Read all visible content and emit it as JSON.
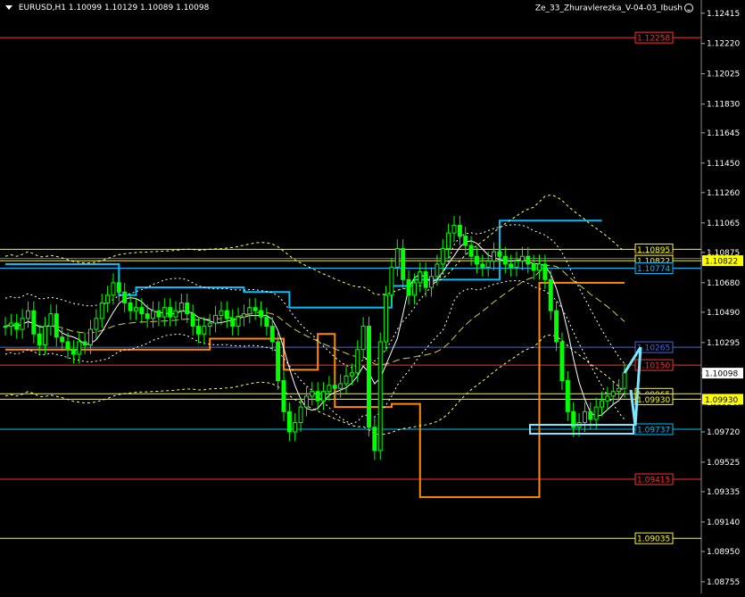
{
  "header": {
    "symbol": "EURUSD,H1",
    "ohlc": "1.10099 1.10129 1.10089 1.10098",
    "indicator": "Ze_33_Zhuravlerezka_V-04-03_Ibush"
  },
  "colors": {
    "background": "#000000",
    "candle_bull": "#00ff00",
    "candle_bear": "#00ff00",
    "axis_text": "#ffffff",
    "cyan_level": "#00bfff",
    "orange_level": "#ff8c00",
    "yellow": "#ffff00",
    "blue": "#0000cd",
    "red": "#ff3030",
    "channel": "#ffff66",
    "arrow": "#7fe6ff"
  },
  "chart_data": {
    "type": "line",
    "title": "EURUSD,H1",
    "ylim": [
      1.0868,
      1.125
    ],
    "y_ticks": [
      "1.12415",
      "1.12220",
      "1.12025",
      "1.11830",
      "1.11645",
      "1.11450",
      "1.11260",
      "1.11065",
      "1.10875",
      "1.10680",
      "1.10490",
      "1.10295",
      "1.10100",
      "1.09910",
      "1.09720",
      "1.09525",
      "1.09335",
      "1.09140",
      "1.08950",
      "1.08755"
    ],
    "grid": false,
    "current_price": "1.10098",
    "close_series": [
      1.104,
      1.1042,
      1.1038,
      1.1045,
      1.105,
      1.1035,
      1.1028,
      1.104,
      1.1048,
      1.1033,
      1.103,
      1.1025,
      1.1022,
      1.103,
      1.1028,
      1.1038,
      1.1045,
      1.1055,
      1.106,
      1.1068,
      1.1062,
      1.1055,
      1.105,
      1.1052,
      1.1048,
      1.1045,
      1.105,
      1.1046,
      1.1052,
      1.1046,
      1.105,
      1.1055,
      1.1048,
      1.104,
      1.1035,
      1.104,
      1.1042,
      1.1047,
      1.105,
      1.1045,
      1.104,
      1.1046,
      1.1048,
      1.1052,
      1.105,
      1.1046,
      1.104,
      1.103,
      1.1005,
      1.0985,
      1.0972,
      1.0978,
      1.0988,
      1.0995,
      1.0998,
      1.0992,
      1.0998,
      1.1002,
      1.1,
      1.1003,
      1.1008,
      1.101,
      1.1025,
      1.104,
      1.0975,
      1.096,
      1.103,
      1.106,
      1.1078,
      1.109,
      1.107,
      1.106,
      1.1068,
      1.1075,
      1.1065,
      1.1072,
      1.108,
      1.109,
      1.11,
      1.1105,
      1.1098,
      1.1092,
      1.1085,
      1.108,
      1.1078,
      1.1082,
      1.1088,
      1.1085,
      1.108,
      1.1078,
      1.1082,
      1.1085,
      1.108,
      1.1076,
      1.108,
      1.107,
      1.105,
      1.103,
      1.1005,
      1.0985,
      1.0975,
      1.0978,
      1.0985,
      1.098,
      1.0988,
      1.0992,
      1.0995,
      1.0998,
      1.1,
      1.101
    ],
    "horizontal_levels": [
      {
        "label": "1.12258",
        "value": 1.12258,
        "color": "#ff3030"
      },
      {
        "label": "1.10895",
        "value": 1.10895,
        "color": "#ffff00"
      },
      {
        "label": "1.10837",
        "value": 1.10837,
        "color": "#ff3030"
      },
      {
        "label": "1.10822",
        "value": 1.10822,
        "color": "#ffff00"
      },
      {
        "label": "1.10774",
        "value": 1.10774,
        "color": "#00bfff"
      },
      {
        "label": "1.10265",
        "value": 1.10265,
        "color": "#4169e1"
      },
      {
        "label": "1.10150",
        "value": 1.1015,
        "color": "#ff3030"
      },
      {
        "label": "1.09965",
        "value": 1.09965,
        "color": "#ffff00"
      },
      {
        "label": "1.09930",
        "value": 1.0993,
        "color": "#ffff00"
      },
      {
        "label": "1.09737",
        "value": 1.09737,
        "color": "#00bfff"
      },
      {
        "label": "1.09415",
        "value": 1.09415,
        "color": "#ff3030"
      },
      {
        "label": "1.09035",
        "value": 1.09035,
        "color": "#ffff00"
      }
    ],
    "badge_levels": [
      {
        "label": "1.10822",
        "value": 1.10822,
        "bg": "#ffff00",
        "fg": "#000000"
      },
      {
        "label": "1.10098",
        "value": 1.10098,
        "bg": "#ffffff",
        "fg": "#000000"
      },
      {
        "label": "1.09930",
        "value": 1.0993,
        "bg": "#ffff00",
        "fg": "#000000"
      }
    ],
    "cyan_step": [
      1.108,
      1.108,
      1.108,
      1.108,
      1.108,
      1.108,
      1.108,
      1.108,
      1.108,
      1.108,
      1.108,
      1.108,
      1.108,
      1.108,
      1.108,
      1.108,
      1.108,
      1.108,
      1.108,
      1.108,
      1.106,
      1.106,
      1.106,
      1.1065,
      1.1065,
      1.1065,
      1.1065,
      1.1065,
      1.1065,
      1.1065,
      1.1065,
      1.1065,
      1.1065,
      1.1065,
      1.1065,
      1.1065,
      1.1065,
      1.1065,
      1.1065,
      1.1065,
      1.1065,
      1.1065,
      1.1062,
      1.1062,
      1.1062,
      1.1062,
      1.1062,
      1.1062,
      1.1062,
      1.1062,
      1.1052,
      1.1052,
      1.1052,
      1.1052,
      1.1052,
      1.1052,
      1.1052,
      1.1052,
      1.1052,
      1.1052,
      1.1052,
      1.1052,
      1.1052,
      1.1052,
      1.1052,
      1.1052,
      1.1052,
      1.1052,
      1.1066,
      1.1066,
      1.1066,
      1.1066,
      1.107,
      1.107,
      1.107,
      1.107,
      1.107,
      1.107,
      1.107,
      1.107,
      1.107,
      1.107,
      1.107,
      1.107,
      1.107,
      1.107,
      1.107,
      1.1108,
      1.1108,
      1.1108,
      1.1108,
      1.1108,
      1.1108,
      1.1108,
      1.1108,
      1.1108,
      1.1108,
      1.1108,
      1.1108,
      1.1108,
      1.1108,
      1.1108,
      1.1108,
      1.1108,
      1.1108,
      1.1108
    ],
    "orange_step": [
      1.1025,
      1.1025,
      1.1025,
      1.1025,
      1.1025,
      1.1025,
      1.1025,
      1.1025,
      1.1025,
      1.1025,
      1.1025,
      1.1025,
      1.1025,
      1.1025,
      1.1025,
      1.1025,
      1.1025,
      1.1025,
      1.1025,
      1.1025,
      1.1025,
      1.1025,
      1.1025,
      1.1025,
      1.1025,
      1.1025,
      1.1025,
      1.1025,
      1.1025,
      1.1025,
      1.1025,
      1.1025,
      1.1025,
      1.1025,
      1.1025,
      1.1025,
      1.1032,
      1.1032,
      1.1032,
      1.1032,
      1.1032,
      1.1032,
      1.1032,
      1.1032,
      1.1032,
      1.1032,
      1.1032,
      1.1032,
      1.1032,
      1.1012,
      1.1012,
      1.1012,
      1.1012,
      1.1012,
      1.1012,
      1.1035,
      1.1035,
      1.1035,
      1.0988,
      1.0988,
      1.0988,
      1.0988,
      1.0988,
      1.0988,
      1.0988,
      1.0988,
      1.0988,
      1.0988,
      1.099,
      1.099,
      1.099,
      1.099,
      1.099,
      1.093,
      1.093,
      1.093,
      1.093,
      1.093,
      1.093,
      1.093,
      1.093,
      1.093,
      1.093,
      1.093,
      1.093,
      1.093,
      1.093,
      1.093,
      1.093,
      1.093,
      1.093,
      1.093,
      1.093,
      1.093,
      1.1068,
      1.1068,
      1.1068,
      1.1068,
      1.1068,
      1.1068,
      1.1068,
      1.1068,
      1.1068,
      1.1068,
      1.1068,
      1.1068,
      1.1068,
      1.1068,
      1.1068,
      1.1068
    ]
  }
}
